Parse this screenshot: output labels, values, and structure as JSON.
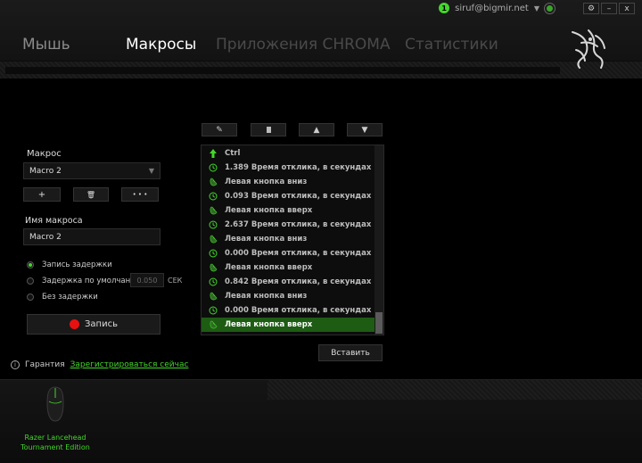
{
  "account": {
    "count": "1",
    "email": "siruf@bigmir.net"
  },
  "window": {
    "settings_label": "⚙",
    "minimize_label": "–",
    "close_label": "x"
  },
  "tabs": [
    {
      "label": "Мышь",
      "state": "inactive"
    },
    {
      "label": "Макросы",
      "state": "active"
    },
    {
      "label": "Приложения CHROMA",
      "state": "dim"
    },
    {
      "label": "Статистики",
      "state": "dim"
    }
  ],
  "macro": {
    "label": "Макрос",
    "selected": "Macro 2",
    "add_label": "+",
    "delete_label": "🗑",
    "more_label": "• • •",
    "name_label": "Имя макроса",
    "name_value": "Macro 2"
  },
  "delay": {
    "options": [
      {
        "label": "Запись задержки",
        "checked": true
      },
      {
        "label": "Задержка по умолчанию",
        "checked": false
      },
      {
        "label": "Без задержки",
        "checked": false
      }
    ],
    "default_value": "0.050",
    "unit": "СЕК"
  },
  "record_label": "Запись",
  "list": {
    "items": [
      {
        "type": "key-up",
        "text": "Ctrl"
      },
      {
        "type": "delay",
        "text": "1.389 Время отклика, в секундах"
      },
      {
        "type": "mouse",
        "text": "Левая кнопка вниз"
      },
      {
        "type": "delay",
        "text": "0.093 Время отклика, в секундах"
      },
      {
        "type": "mouse",
        "text": "Левая кнопка вверх"
      },
      {
        "type": "delay",
        "text": "2.637 Время отклика, в секундах"
      },
      {
        "type": "mouse",
        "text": "Левая кнопка вниз"
      },
      {
        "type": "delay",
        "text": "0.000 Время отклика, в секундах"
      },
      {
        "type": "mouse",
        "text": "Левая кнопка вверх"
      },
      {
        "type": "delay",
        "text": "0.842 Время отклика, в секундах"
      },
      {
        "type": "mouse",
        "text": "Левая кнопка вниз"
      },
      {
        "type": "delay",
        "text": "0.000 Время отклика, в секундах"
      },
      {
        "type": "mouse",
        "text": "Левая кнопка вверх",
        "selected": true
      }
    ]
  },
  "insert_label": "Вставить",
  "warranty": {
    "label": "Гарантия",
    "link": "Зарегистрироваться сейчас"
  },
  "device": {
    "name_line1": "Razer Lancehead",
    "name_line2": "Tournament Edition"
  },
  "colors": {
    "accent": "#44d62c",
    "selected_row": "#1e5c14",
    "record_dot": "#e81010"
  }
}
